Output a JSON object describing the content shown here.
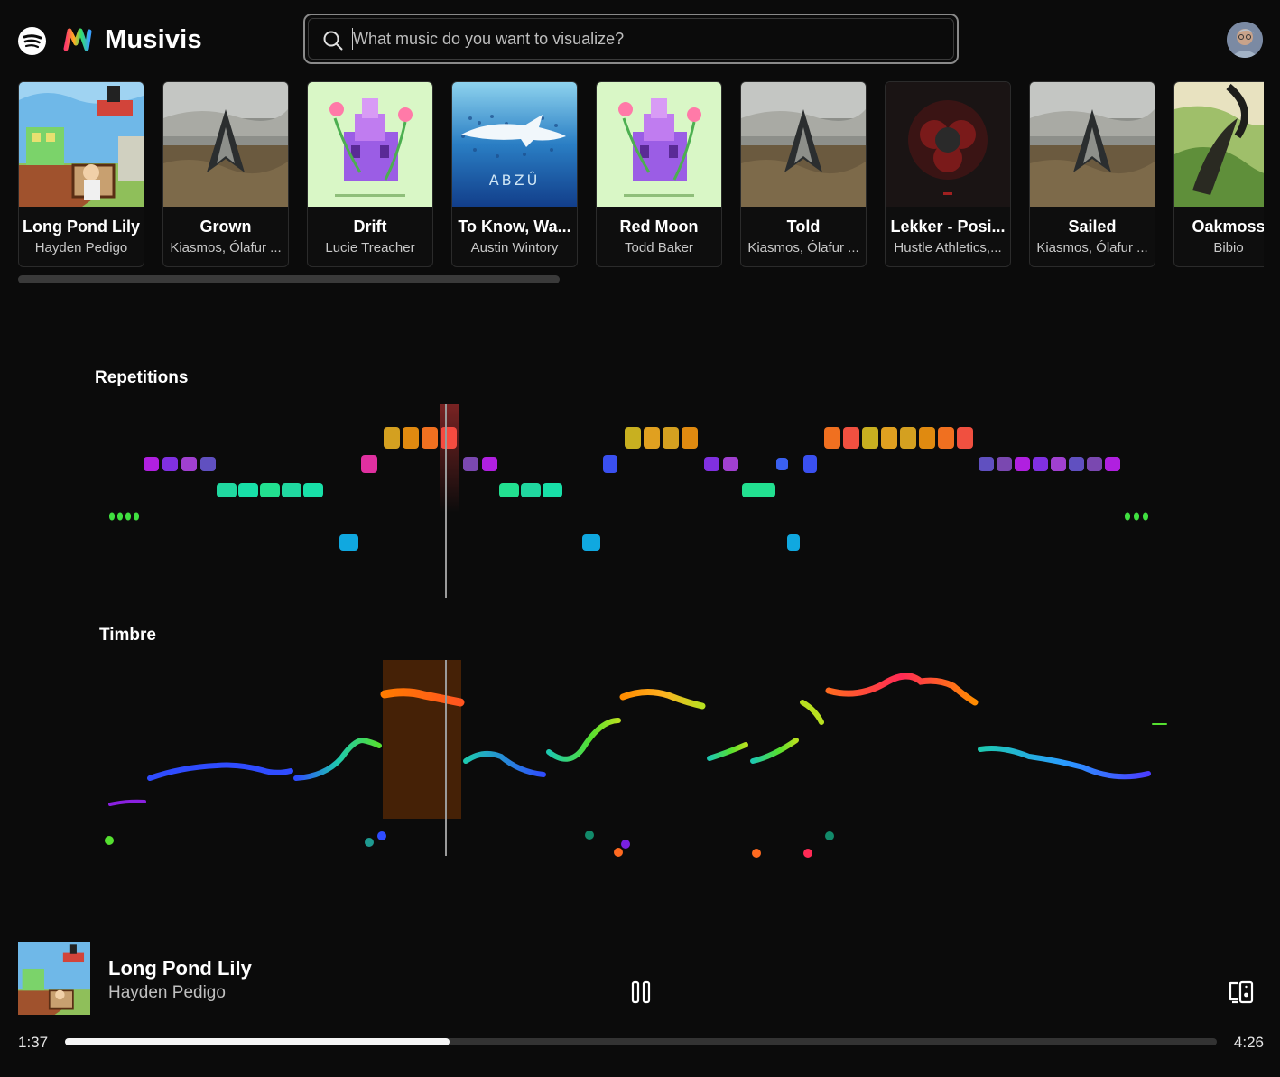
{
  "header": {
    "app_name": "Musivis",
    "spotify_icon": "spotify-icon",
    "logo_icon": "musivis-logo-icon",
    "search": {
      "placeholder": "What music do you want to visualize?",
      "value": "",
      "icon": "search-icon"
    },
    "avatar_icon": "user-avatar"
  },
  "albums": [
    {
      "title": "Long Pond Lily",
      "artist": "Hayden Pedigo",
      "art": "pedigo"
    },
    {
      "title": "Grown",
      "artist": "Kiasmos, Ólafur ...",
      "art": "kiasmos"
    },
    {
      "title": "Drift",
      "artist": "Lucie Treacher",
      "art": "monument"
    },
    {
      "title": "To Know, Wa...",
      "artist": "Austin Wintory",
      "art": "abzu"
    },
    {
      "title": "Red Moon",
      "artist": "Todd Baker",
      "art": "monument"
    },
    {
      "title": "Told",
      "artist": "Kiasmos, Ólafur ...",
      "art": "kiasmos"
    },
    {
      "title": "Lekker - Posi...",
      "artist": "Hustle Athletics,...",
      "art": "lekker"
    },
    {
      "title": "Sailed",
      "artist": "Kiasmos, Ólafur ...",
      "art": "kiasmos"
    },
    {
      "title": "Oakmoss",
      "artist": "Bibio",
      "art": "oakmoss"
    }
  ],
  "abzu_text": "ABZÛ",
  "visualizations": {
    "repetitions_label": "Repetitions",
    "timbre_label": "Timbre",
    "playhead_progress": 0.38
  },
  "player": {
    "title": "Long Pond Lily",
    "artist": "Hayden Pedigo",
    "current_time": "1:37",
    "total_time": "4:26",
    "progress": 0.334,
    "pause_icon": "pause-icon",
    "devices_icon": "connect-device-icon"
  },
  "colors": {
    "background": "#0b0b0b",
    "accent": "#f5f5f5"
  }
}
